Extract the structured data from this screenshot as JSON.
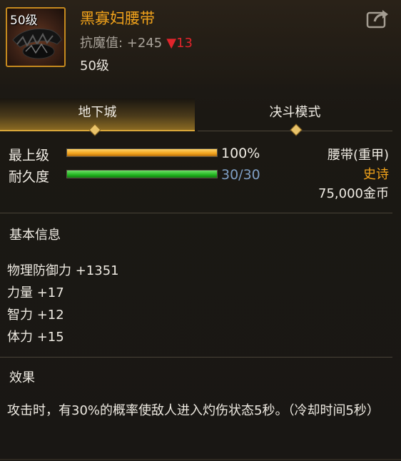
{
  "item": {
    "level_badge": "50级",
    "name": "黑寡妇腰带",
    "resist_label": "抗魔值: +245",
    "resist_change_arrow": "▼",
    "resist_change": "13",
    "required_level": "50级",
    "name_color": "#f2a31b"
  },
  "icons": {
    "share": "share-out-icon",
    "item": "belt-item-icon"
  },
  "tabs": [
    {
      "label": "地下城",
      "active": true
    },
    {
      "label": "决斗模式",
      "active": false
    }
  ],
  "bars": {
    "upgrade": {
      "label": "最上级",
      "value_text": "100%",
      "fill": 1.0,
      "color": "#f0a21c"
    },
    "durability": {
      "label": "耐久度",
      "value_text": "30/30",
      "fill": 1.0,
      "color": "#22b51f"
    }
  },
  "meta": {
    "type": "腰带(重甲)",
    "rarity": "史诗",
    "rarity_color": "#f2a31b",
    "price": "75,000金币"
  },
  "basic_info": {
    "title": "基本信息",
    "stats": [
      "物理防御力 +1351",
      "力量 +17",
      "智力 +12",
      "体力 +15"
    ]
  },
  "effect": {
    "title": "效果",
    "text": "攻击时，有30%的概率使敌人进入灼伤状态5秒。（冷却时间5秒）"
  }
}
